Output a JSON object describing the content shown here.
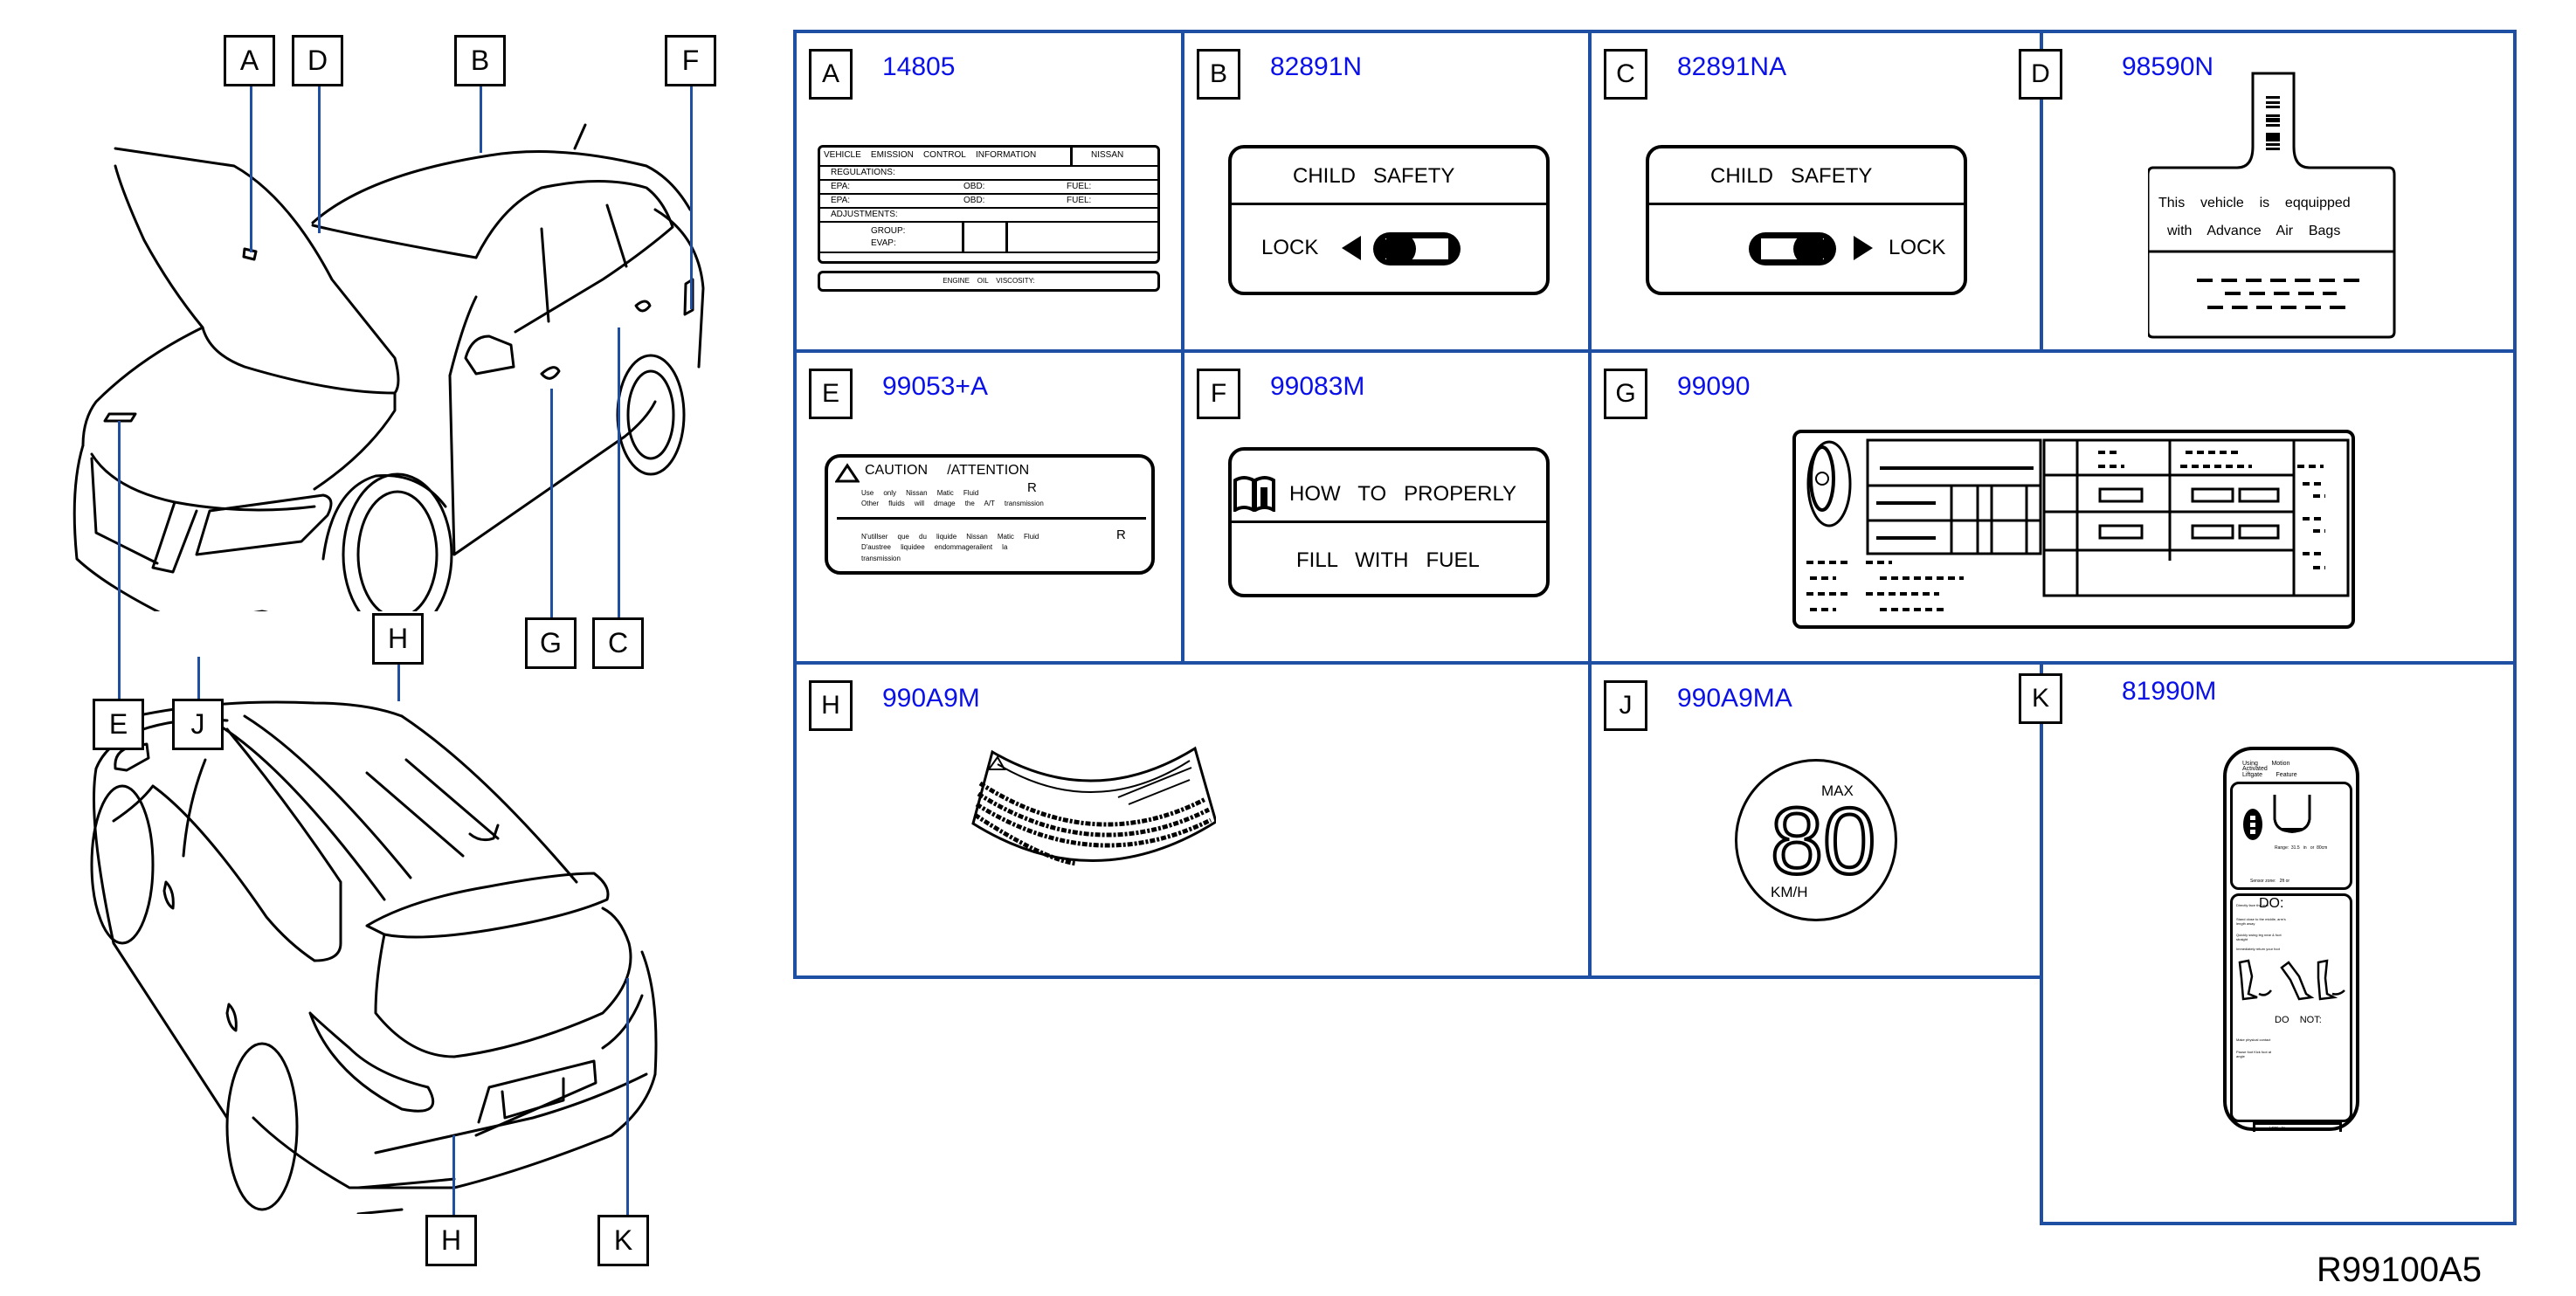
{
  "diagram_code": "R99100A5",
  "callouts": {
    "front_view": [
      "A",
      "D",
      "B",
      "F",
      "G",
      "C",
      "E",
      "J"
    ],
    "rear_view": [
      "H",
      "H",
      "K"
    ]
  },
  "colors": {
    "grid": "#1f4fa3",
    "part_number": "#0a10e8",
    "leader": "#1f4fa3"
  },
  "panels": {
    "A": {
      "letter": "A",
      "part": "14805",
      "title_cells": [
        "VEHICLE",
        "EMISSION",
        "CONTROL",
        "INFORMATION"
      ],
      "brand": "NISSAN",
      "regulations": "REGULATIONS:",
      "rows": [
        {
          "epa": "EPA:",
          "obd": "OBD:",
          "fuel": "FUEL:"
        },
        {
          "epa": "EPA:",
          "obd": "OBD:",
          "fuel": "FUEL:"
        }
      ],
      "adjustments": "ADJUSTMENTS:",
      "group": "GROUP:",
      "evap": "EVAP:",
      "oil": "ENGINE    OIL    VISCOSITY:"
    },
    "B": {
      "letter": "B",
      "part": "82891N",
      "title": "CHILD   SAFETY",
      "lock": "LOCK",
      "direction": "left"
    },
    "C": {
      "letter": "C",
      "part": "82891NA",
      "title": "CHILD   SAFETY",
      "lock": "LOCK",
      "direction": "right"
    },
    "D": {
      "letter": "D",
      "part": "98590N",
      "line1": "This    vehicle    is    eqquipped",
      "line2": "with    Advance    Air    Bags"
    },
    "E": {
      "letter": "E",
      "part": "99053+A",
      "heading": "CAUTION     /ATTENTION",
      "en1": "Use     only     Nissan     Matic     Fluid",
      "en2": "Other     fluids     will     dmage     the     A/T     transmission",
      "fr1": "N'utillser     que     du     liquide     Nissan     Matic     Fluid",
      "fr2": "D'austree     liquidee     endommagerailent     la",
      "fr3": "transmission",
      "reg": "R"
    },
    "F": {
      "letter": "F",
      "part": "99083M",
      "line1": "HOW   TO   PROPERLY",
      "line2": "FILL   WITH   FUEL"
    },
    "G": {
      "letter": "G",
      "part": "99090"
    },
    "H": {
      "letter": "H",
      "part": "990A9M"
    },
    "J": {
      "letter": "J",
      "part": "990A9MA",
      "max": "MAX",
      "speed": "80",
      "unit": "KM/H"
    },
    "K": {
      "letter": "K",
      "part": "81990M",
      "title1": "Using        Motion",
      "title2": "Activated",
      "title3": "Liftgate        Feature",
      "range": "Range:  31.5   in   or  80cm",
      "sensor": "Sensor zone:   2ft or",
      "do": "DO:",
      "do_items": [
        "Directly face    the rear",
        "Stand close    to the middle, arm's length away",
        "Quickly swing    leg near & foot straight",
        "Immediately return your foot"
      ],
      "do_not": "DO    NOT:",
      "dont_items": [
        "Make physical contact",
        "Pause    foot  Kick    foot  at    angle"
      ],
      "footer": "Label    to"
    }
  }
}
